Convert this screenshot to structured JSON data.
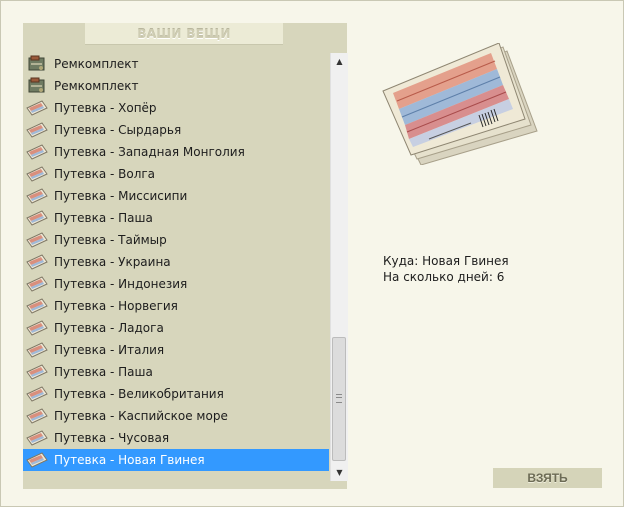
{
  "panel": {
    "title": "ВАШИ ВЕЩИ"
  },
  "items": [
    {
      "label": "Ремкомплект",
      "icon": "repair-kit-icon"
    },
    {
      "label": "Ремкомплект",
      "icon": "repair-kit-icon"
    },
    {
      "label": "Путевка - Хопёр",
      "icon": "voucher-icon"
    },
    {
      "label": "Путевка - Сырдарья",
      "icon": "voucher-icon"
    },
    {
      "label": "Путевка - Западная Монголия",
      "icon": "voucher-icon"
    },
    {
      "label": "Путевка - Волга",
      "icon": "voucher-icon"
    },
    {
      "label": "Путевка - Миссисипи",
      "icon": "voucher-icon"
    },
    {
      "label": "Путевка - Паша",
      "icon": "voucher-icon"
    },
    {
      "label": "Путевка - Таймыр",
      "icon": "voucher-icon"
    },
    {
      "label": "Путевка - Украина",
      "icon": "voucher-icon"
    },
    {
      "label": "Путевка - Индонезия",
      "icon": "voucher-icon"
    },
    {
      "label": "Путевка - Норвегия",
      "icon": "voucher-icon"
    },
    {
      "label": "Путевка - Ладога",
      "icon": "voucher-icon"
    },
    {
      "label": "Путевка - Италия",
      "icon": "voucher-icon"
    },
    {
      "label": "Путевка - Паша",
      "icon": "voucher-icon"
    },
    {
      "label": "Путевка - Великобритания",
      "icon": "voucher-icon"
    },
    {
      "label": "Путевка - Каспийское море",
      "icon": "voucher-icon"
    },
    {
      "label": "Путевка - Чусовая",
      "icon": "voucher-icon"
    },
    {
      "label": "Путевка - Новая Гвинея",
      "icon": "voucher-icon",
      "selected": true
    }
  ],
  "details": {
    "destination": "Куда: Новая Гвинея",
    "days": "На сколько дней: 6"
  },
  "take_button": {
    "label": "ВЗЯТЬ"
  },
  "colors": {
    "selection": "#3399ff",
    "panel_bg": "#d7d6bc",
    "page_bg": "#f7f6ea"
  }
}
